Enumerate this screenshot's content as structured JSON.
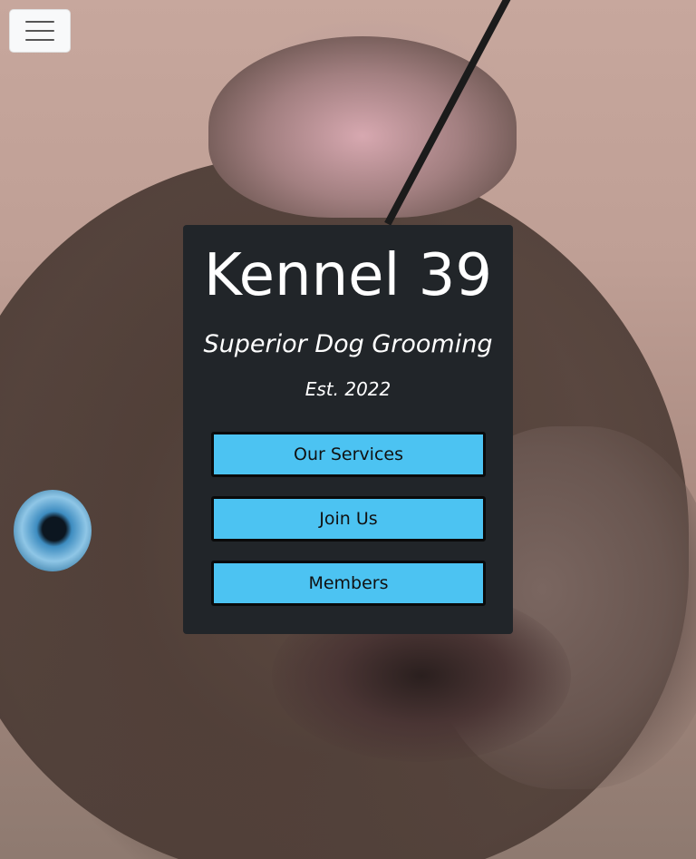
{
  "nav": {
    "menu_icon": "hamburger-menu-icon"
  },
  "hero": {
    "image": "blurred close-up of a brown puppy with a blue eye"
  },
  "card": {
    "title": "Kennel 39",
    "subtitle": "Superior Dog Grooming",
    "established": "Est. 2022",
    "buttons": {
      "services": "Our Services",
      "join": "Join Us",
      "members": "Members"
    }
  },
  "colors": {
    "card_bg": "#212529",
    "button_bg": "#4cc3f2",
    "button_border": "#0a0a0a",
    "text": "#ffffff"
  }
}
